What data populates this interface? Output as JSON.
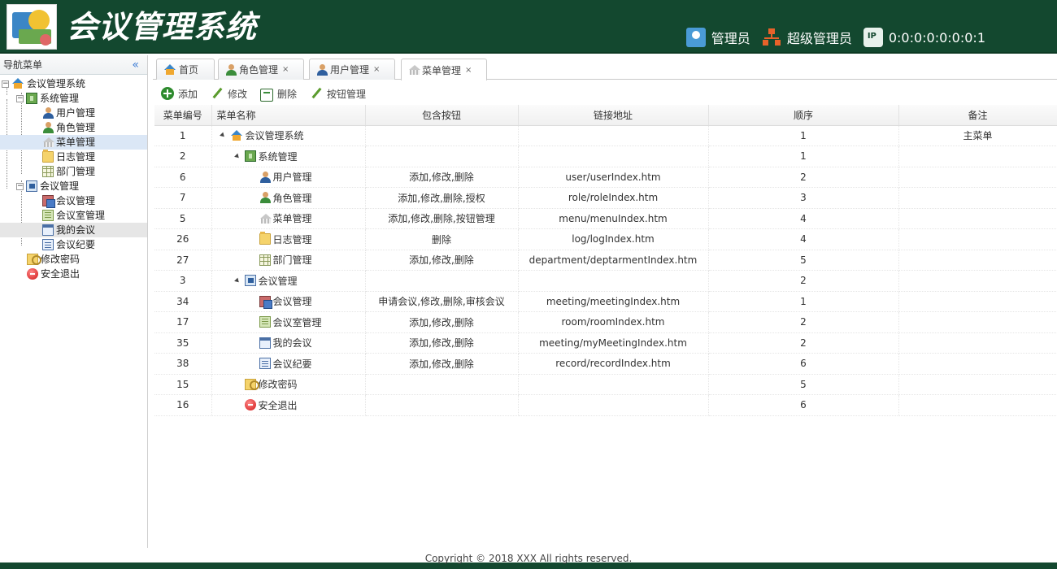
{
  "header": {
    "app_title": "会议管理系统",
    "role_name": "管理员",
    "role_level": "超级管理员",
    "ip": "0:0:0:0:0:0:0:1"
  },
  "sidebar": {
    "title": "导航菜单",
    "collapse_glyph": "«",
    "tree": {
      "root": "会议管理系统",
      "sys": "系统管理",
      "user": "用户管理",
      "role": "角色管理",
      "menu": "菜单管理",
      "log": "日志管理",
      "dept": "部门管理",
      "meetgrp": "会议管理",
      "meet": "会议管理",
      "room": "会议室管理",
      "my": "我的会议",
      "rec": "会议纪要",
      "pwd": "修改密码",
      "exit": "安全退出"
    }
  },
  "tabs": {
    "home": "首页",
    "role": "角色管理",
    "user": "用户管理",
    "menu": "菜单管理",
    "close": "×"
  },
  "toolbar": {
    "add": "添加",
    "edit": "修改",
    "delete": "删除",
    "buttons": "按钮管理"
  },
  "grid": {
    "headers": {
      "id": "菜单编号",
      "name": "菜单名称",
      "buttons": "包含按钮",
      "url": "链接地址",
      "order": "顺序",
      "remark": "备注"
    },
    "rows": [
      {
        "id": "1",
        "name": "会议管理系统",
        "buttons": "",
        "url": "",
        "order": "1",
        "remark": "主菜单",
        "level": 0,
        "icon": "home-icon",
        "expand": true
      },
      {
        "id": "2",
        "name": "系统管理",
        "buttons": "",
        "url": "",
        "order": "1",
        "remark": "",
        "level": 1,
        "icon": "system-icon",
        "expand": true
      },
      {
        "id": "6",
        "name": "用户管理",
        "buttons": "添加,修改,删除",
        "url": "user/userIndex.htm",
        "order": "2",
        "remark": "",
        "level": 2,
        "icon": "user-icon",
        "expand": false
      },
      {
        "id": "7",
        "name": "角色管理",
        "buttons": "添加,修改,删除,授权",
        "url": "role/roleIndex.htm",
        "order": "3",
        "remark": "",
        "level": 2,
        "icon": "role-icon",
        "expand": false
      },
      {
        "id": "5",
        "name": "菜单管理",
        "buttons": "添加,修改,删除,按钮管理",
        "url": "menu/menuIndex.htm",
        "order": "4",
        "remark": "",
        "level": 2,
        "icon": "menu-icon",
        "expand": false
      },
      {
        "id": "26",
        "name": "日志管理",
        "buttons": "删除",
        "url": "log/logIndex.htm",
        "order": "4",
        "remark": "",
        "level": 2,
        "icon": "log-icon",
        "expand": false
      },
      {
        "id": "27",
        "name": "部门管理",
        "buttons": "添加,修改,删除",
        "url": "department/deptarmentIndex.htm",
        "order": "5",
        "remark": "",
        "level": 2,
        "icon": "department-icon",
        "expand": false
      },
      {
        "id": "3",
        "name": "会议管理",
        "buttons": "",
        "url": "",
        "order": "2",
        "remark": "",
        "level": 1,
        "icon": "meeting-group-icon",
        "expand": true
      },
      {
        "id": "34",
        "name": "会议管理",
        "buttons": "申请会议,修改,删除,审核会议",
        "url": "meeting/meetingIndex.htm",
        "order": "1",
        "remark": "",
        "level": 2,
        "icon": "meeting-icon",
        "expand": false
      },
      {
        "id": "17",
        "name": "会议室管理",
        "buttons": "添加,修改,删除",
        "url": "room/roomIndex.htm",
        "order": "2",
        "remark": "",
        "level": 2,
        "icon": "room-icon",
        "expand": false
      },
      {
        "id": "35",
        "name": "我的会议",
        "buttons": "添加,修改,删除",
        "url": "meeting/myMeetingIndex.htm",
        "order": "2",
        "remark": "",
        "level": 2,
        "icon": "my-meeting-icon",
        "expand": false
      },
      {
        "id": "38",
        "name": "会议纪要",
        "buttons": "添加,修改,删除",
        "url": "record/recordIndex.htm",
        "order": "6",
        "remark": "",
        "level": 2,
        "icon": "record-icon",
        "expand": false
      },
      {
        "id": "15",
        "name": "修改密码",
        "buttons": "",
        "url": "",
        "order": "5",
        "remark": "",
        "level": 1,
        "icon": "password-icon",
        "expand": false
      },
      {
        "id": "16",
        "name": "安全退出",
        "buttons": "",
        "url": "",
        "order": "6",
        "remark": "",
        "level": 1,
        "icon": "exit-icon",
        "expand": false
      }
    ]
  },
  "footer": {
    "copyright": "Copyright © 2018 XXX All rights reserved."
  }
}
